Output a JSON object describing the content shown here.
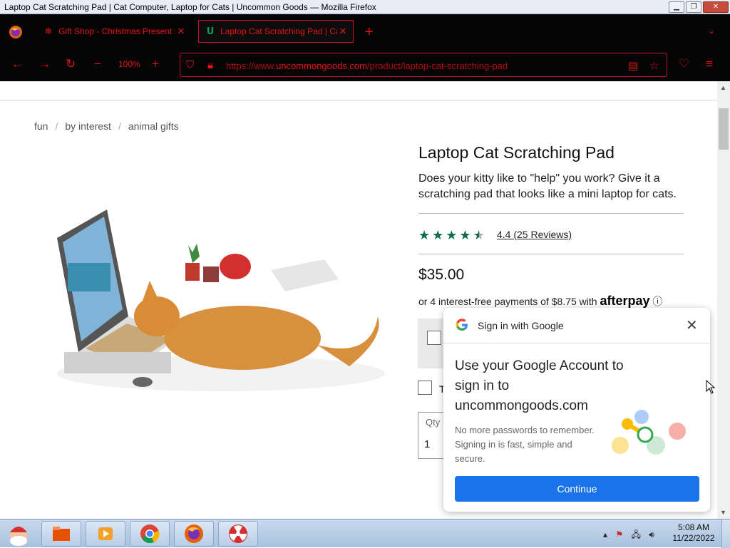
{
  "window": {
    "title": "Laptop Cat Scratching Pad | Cat Computer, Laptop for Cats | Uncommon Goods — Mozilla Firefox",
    "controls": {
      "minimize": "▁",
      "maximize": "❐",
      "close": "✕"
    }
  },
  "browser": {
    "tabs": [
      {
        "label": "Gift Shop - Christmas Present I",
        "icon": "snowflake-icon",
        "close": "✕"
      },
      {
        "label": "Laptop Cat Scratching Pad | Ca",
        "icon": "uncommongoods-icon",
        "close": "✕"
      }
    ],
    "new_tab": "+",
    "tab_list": "⌄",
    "zoom": "100%",
    "zoom_out": "−",
    "zoom_in": "+",
    "url_prefix": "https://www.",
    "url_domain": "uncommongoods.com",
    "url_path": "/product/laptop-cat-scratching-pad"
  },
  "page": {
    "breadcrumbs": [
      "fun",
      "by interest",
      "animal gifts"
    ],
    "breadcrumb_sep": "/",
    "product": {
      "title": "Laptop Cat Scratching Pad",
      "description": "Does your kitty like to \"help\" you work? Give it a scratching pad that looks like a mini laptop for cats.",
      "rating": 4.4,
      "rating_text": "4.4 (25 Reviews)",
      "price": "$35.00",
      "afterpay_text": "or 4 interest-free payments of $8.75 with",
      "afterpay_brand": "afterpay",
      "afterpay_info": "ⓘ",
      "option_letter": "T",
      "qty_label": "Qty",
      "qty_value": "1"
    }
  },
  "google_popup": {
    "header": "Sign in with Google",
    "close": "✕",
    "heading": "Use your Google Account to sign in to uncommongoods.com",
    "body": "No more passwords to remember. Signing in is fast, simple and secure.",
    "button": "Continue"
  },
  "taskbar": {
    "time": "5:08 AM",
    "date": "11/22/2022",
    "apps": [
      "file-manager-icon",
      "media-player-icon",
      "chrome-icon",
      "firefox-icon",
      "radiation-icon"
    ]
  },
  "colors": {
    "browser_accent": "#e41515",
    "star_green": "#0f6e45",
    "google_blue": "#1a73e8"
  }
}
